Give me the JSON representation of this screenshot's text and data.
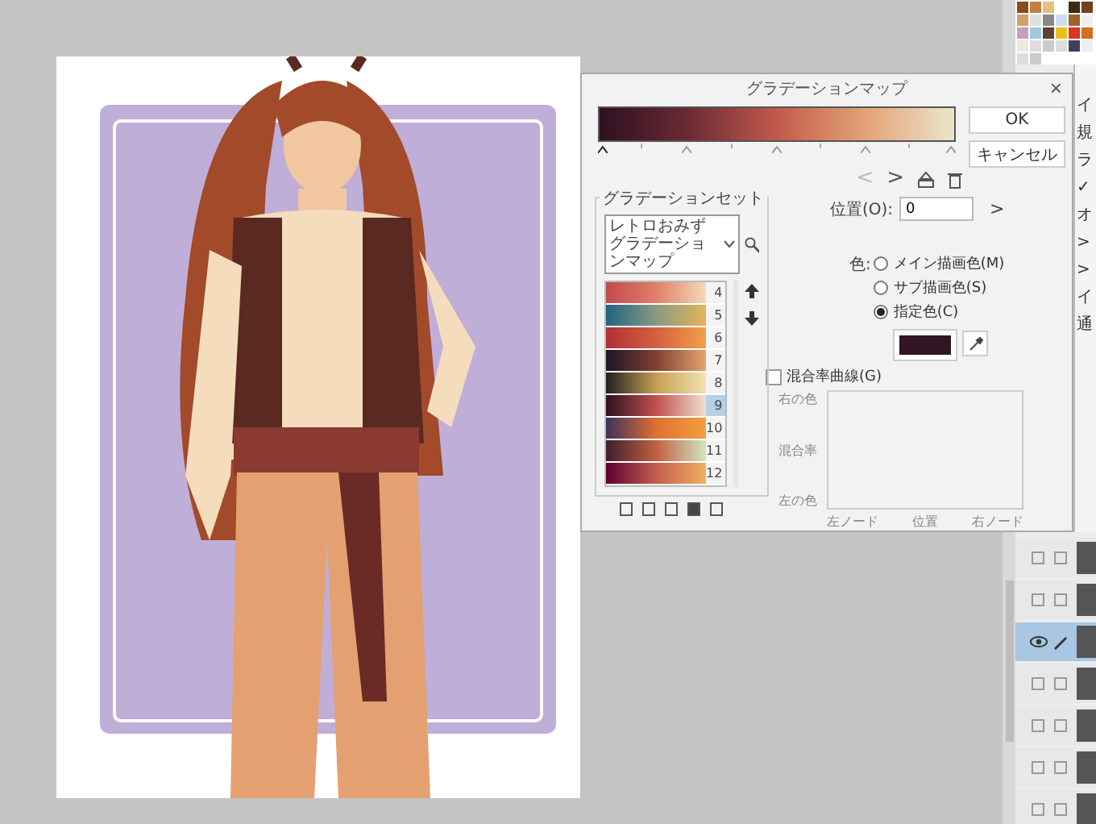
{
  "dialog": {
    "title": "グラデーションマップ",
    "close": "×",
    "ok": "OK",
    "cancel": "キャンセル",
    "nav": {
      "prev": "<",
      "next": ">"
    },
    "set_group": {
      "title": "グラデーションセット",
      "dropdown": "レトロおみずグラデーションマップ",
      "items": [
        {
          "number": "4",
          "selected": false
        },
        {
          "number": "5",
          "selected": false
        },
        {
          "number": "6",
          "selected": false
        },
        {
          "number": "7",
          "selected": false
        },
        {
          "number": "8",
          "selected": false
        },
        {
          "number": "9",
          "selected": true
        },
        {
          "number": "10",
          "selected": false
        },
        {
          "number": "11",
          "selected": false
        },
        {
          "number": "12",
          "selected": false
        }
      ]
    },
    "position": {
      "label": "位置(O):",
      "value": "0",
      "next": ">"
    },
    "color": {
      "label": "色:",
      "options": [
        {
          "label": "メイン描画色(M)",
          "selected": false
        },
        {
          "label": "サブ描画色(S)",
          "selected": false
        },
        {
          "label": "指定色(C)",
          "selected": true
        }
      ],
      "swatch": {
        "color": "#321422"
      }
    },
    "curve": {
      "label": "混合率曲線(G)",
      "checked": false,
      "y_labels": [
        "右の色",
        "混合率",
        "左の色"
      ],
      "x_labels": [
        "左ノード",
        "位置",
        "右ノード"
      ]
    }
  },
  "side_panel": {
    "texts": [
      "イ",
      "規",
      "ラ",
      "✓",
      "オ",
      ">",
      ">",
      "イ",
      "通"
    ]
  },
  "layers": [
    {
      "visible": false,
      "selected": false
    },
    {
      "visible": false,
      "selected": false
    },
    {
      "visible": true,
      "selected": true
    },
    {
      "visible": false,
      "selected": false
    },
    {
      "visible": false,
      "selected": false
    },
    {
      "visible": false,
      "selected": false
    },
    {
      "visible": false,
      "selected": false
    }
  ]
}
